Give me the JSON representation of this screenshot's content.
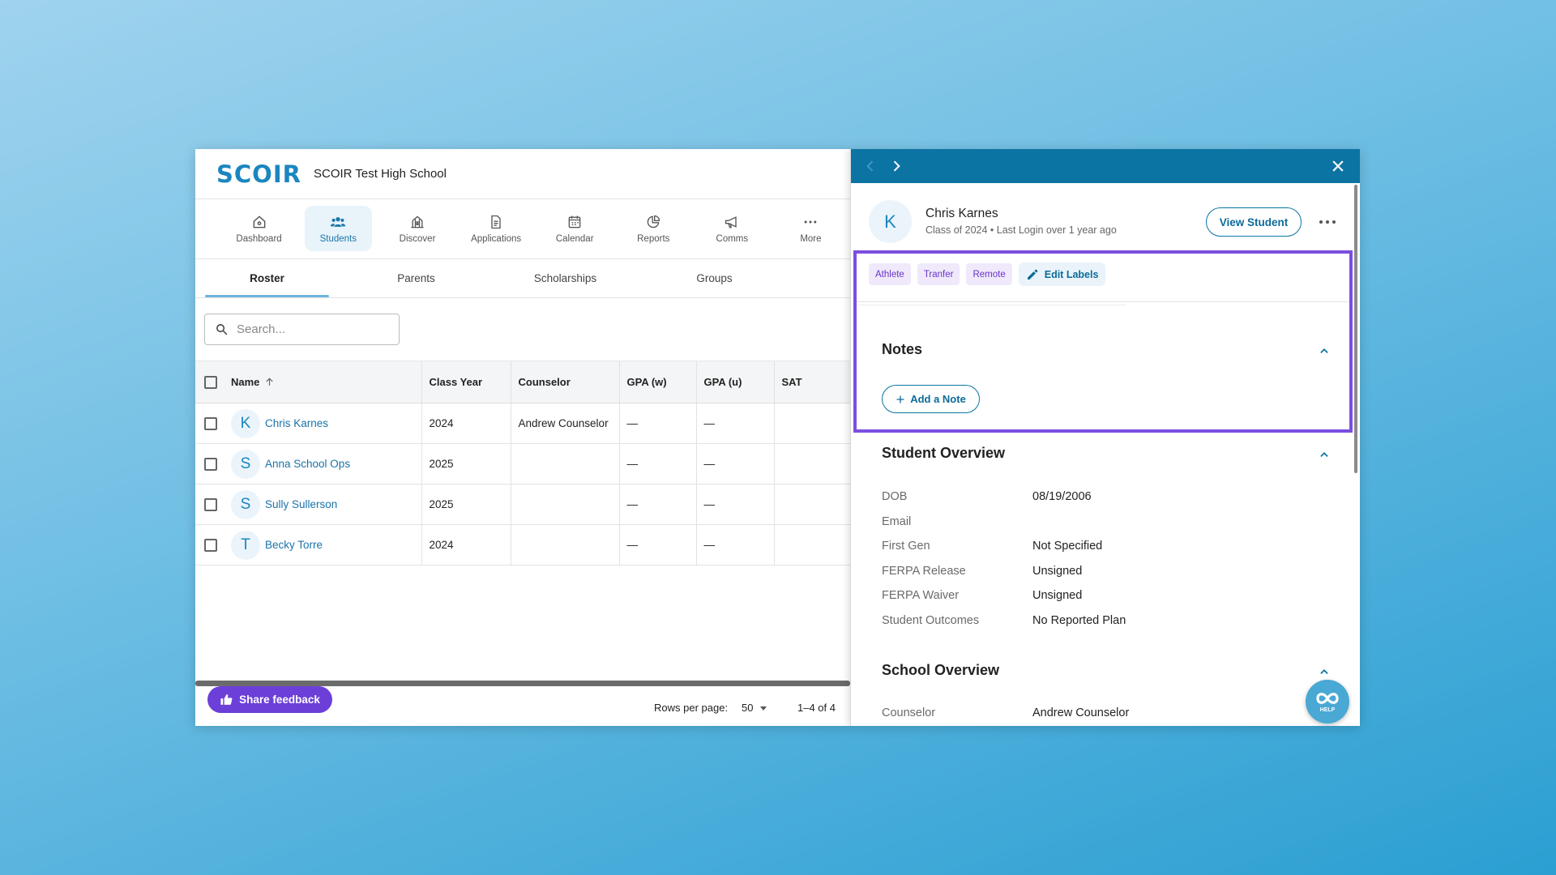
{
  "app": {
    "logo_text": "SCOIR",
    "school_name": "SCOIR Test High School"
  },
  "nav": [
    {
      "label": "Dashboard",
      "icon": "home-icon"
    },
    {
      "label": "Students",
      "icon": "people-icon",
      "active": true
    },
    {
      "label": "Discover",
      "icon": "university-icon"
    },
    {
      "label": "Applications",
      "icon": "document-icon"
    },
    {
      "label": "Calendar",
      "icon": "calendar-icon"
    },
    {
      "label": "Reports",
      "icon": "pie-chart-icon"
    },
    {
      "label": "Comms",
      "icon": "megaphone-icon"
    },
    {
      "label": "More",
      "icon": "more-horizontal-icon"
    }
  ],
  "subtabs": [
    "Roster",
    "Parents",
    "Scholarships",
    "Groups"
  ],
  "search": {
    "placeholder": "Search..."
  },
  "table": {
    "columns": [
      "Name",
      "Class Year",
      "Counselor",
      "GPA (w)",
      "GPA (u)",
      "SAT"
    ],
    "rows": [
      {
        "initial": "K",
        "name": "Chris Karnes",
        "class_year": "2024",
        "counselor": "Andrew Counselor",
        "gpa_w": "—",
        "gpa_u": "—",
        "sat": ""
      },
      {
        "initial": "S",
        "name": "Anna School Ops",
        "class_year": "2025",
        "counselor": "",
        "gpa_w": "—",
        "gpa_u": "—",
        "sat": ""
      },
      {
        "initial": "S",
        "name": "Sully Sullerson",
        "class_year": "2025",
        "counselor": "",
        "gpa_w": "—",
        "gpa_u": "—",
        "sat": ""
      },
      {
        "initial": "T",
        "name": "Becky Torre",
        "class_year": "2024",
        "counselor": "",
        "gpa_w": "—",
        "gpa_u": "—",
        "sat": ""
      }
    ]
  },
  "footer": {
    "feedback_label": "Share feedback",
    "rows_per_page_label": "Rows per page:",
    "rows_per_page_value": "50",
    "page_range": "1–4 of 4"
  },
  "panel": {
    "student_initial": "K",
    "student_name": "Chris Karnes",
    "student_subtitle": "Class of 2024 • Last Login over 1 year ago",
    "view_button": "View Student",
    "labels": [
      "Athlete",
      "Tranfer",
      "Remote"
    ],
    "edit_labels": "Edit Labels",
    "notes_title": "Notes",
    "add_note_label": "Add a Note",
    "overview_title": "Student Overview",
    "overview": [
      {
        "label": "DOB",
        "value": "08/19/2006"
      },
      {
        "label": "Email",
        "value": ""
      },
      {
        "label": "First Gen",
        "value": "Not Specified"
      },
      {
        "label": "FERPA Release",
        "value": "Unsigned"
      },
      {
        "label": "FERPA Waiver",
        "value": "Unsigned"
      },
      {
        "label": "Student Outcomes",
        "value": "No Reported Plan"
      }
    ],
    "school_overview_title": "School Overview",
    "school_overview": [
      {
        "label": "Counselor",
        "value": "Andrew Counselor"
      }
    ],
    "help_label": "HELP"
  },
  "colors": {
    "brand": "#1b86bf",
    "panel_header": "#0c74a3",
    "highlight": "#7b4fe0",
    "feedback": "#6c3fd8"
  }
}
